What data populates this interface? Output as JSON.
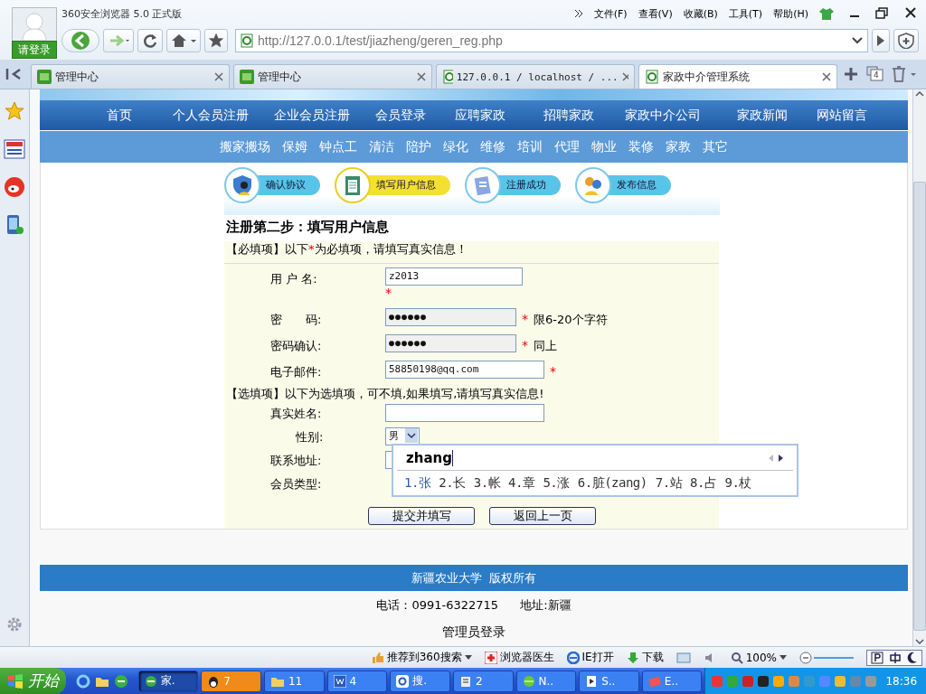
{
  "browser": {
    "title": "360安全浏览器 5.0 正式版",
    "login": "请登录",
    "menu": [
      "文件(F)",
      "查看(V)",
      "收藏(B)",
      "工具(T)",
      "帮助(H)"
    ],
    "url": "http://127.0.0.1/test/jiazheng/geren_reg.php",
    "tab_count": "4",
    "tabs": [
      {
        "label": "管理中心",
        "selected": false
      },
      {
        "label": "管理中心",
        "selected": false
      },
      {
        "label": "127.0.0.1 / localhost / ...",
        "selected": false
      },
      {
        "label": "家政中介管理系统",
        "selected": true
      }
    ]
  },
  "page": {
    "nav": [
      "首页",
      "个人会员注册",
      "企业会员注册",
      "会员登录",
      "应聘家政",
      "招聘家政",
      "家政中介公司",
      "家政新闻",
      "网站留言"
    ],
    "categories": [
      "搬家搬场",
      "保姆",
      "钟点工",
      "清洁",
      "陪护",
      "绿化",
      "维修",
      "培训",
      "代理",
      "物业",
      "装修",
      "家教",
      "其它"
    ],
    "steps": [
      {
        "label": "确认协议",
        "selected": false
      },
      {
        "label": "填写用户信息",
        "selected": true
      },
      {
        "label": "注册成功",
        "selected": false
      },
      {
        "label": "发布信息",
        "selected": false
      }
    ],
    "form_title": "注册第二步：填写用户信息",
    "required_note": {
      "before": "【必填项】以下",
      "mark": "*",
      "after": "为必填项，请填写真实信息！"
    },
    "required_fields": [
      {
        "label": "用 户 名:",
        "value": "z2013",
        "required": true
      },
      {
        "label": "密　　码:",
        "value": "●●●●●●",
        "required": true,
        "note": "限6-20个字符"
      },
      {
        "label": "密码确认:",
        "value": "●●●●●●",
        "required": true,
        "note": "同上"
      },
      {
        "label": "电子邮件:",
        "value": "58850198@qq.com",
        "required": true
      }
    ],
    "optional_note": "【选填项】以下为选填项，可不填,如果填写,请填写真实信息!",
    "optional_fields": [
      {
        "label": "真实姓名:",
        "kind": "text"
      },
      {
        "label": "性别:",
        "kind": "select",
        "value": "男"
      },
      {
        "label": "联系地址:",
        "kind": "text"
      },
      {
        "label": "会员类型:",
        "kind": "hidden"
      }
    ],
    "buttons": [
      "提交并填写",
      "返回上一页"
    ],
    "copyright": "新疆农业大学  版权所有",
    "phone": "电话：0991-6322715",
    "address": "地址:新疆",
    "admin_link": "管理员登录"
  },
  "ime": {
    "input": "zhang",
    "candidates": [
      {
        "text": "1.张",
        "selected": true
      },
      {
        "text": "2.长",
        "selected": false
      },
      {
        "text": "3.帐",
        "selected": false
      },
      {
        "text": "4.章",
        "selected": false
      },
      {
        "text": "5.涨",
        "selected": false
      },
      {
        "text": "6.脏(zang)",
        "selected": false
      },
      {
        "text": "7.站",
        "selected": false
      },
      {
        "text": "8.占",
        "selected": false
      },
      {
        "text": "9.杖",
        "selected": false
      }
    ]
  },
  "status_bar": {
    "recommend": "推荐到360搜索",
    "doctor": "浏览器医生",
    "ie_open": "IE打开",
    "download": "下载",
    "zoom": "100%"
  },
  "taskbar": {
    "start": "开始",
    "clock": "18:36",
    "tasks": [
      {
        "label": "家.",
        "selected": true,
        "flashing": false
      },
      {
        "label": "7",
        "selected": false,
        "flashing": true
      },
      {
        "label": "11",
        "selected": false,
        "flashing": false
      },
      {
        "label": "4",
        "selected": false,
        "flashing": false
      },
      {
        "label": "搜.",
        "selected": false,
        "flashing": false
      },
      {
        "label": "2",
        "selected": false,
        "flashing": false
      },
      {
        "label": "N..",
        "selected": false,
        "flashing": false
      },
      {
        "label": "S..",
        "selected": false,
        "flashing": false
      },
      {
        "label": "E..",
        "selected": false,
        "flashing": false
      }
    ]
  }
}
